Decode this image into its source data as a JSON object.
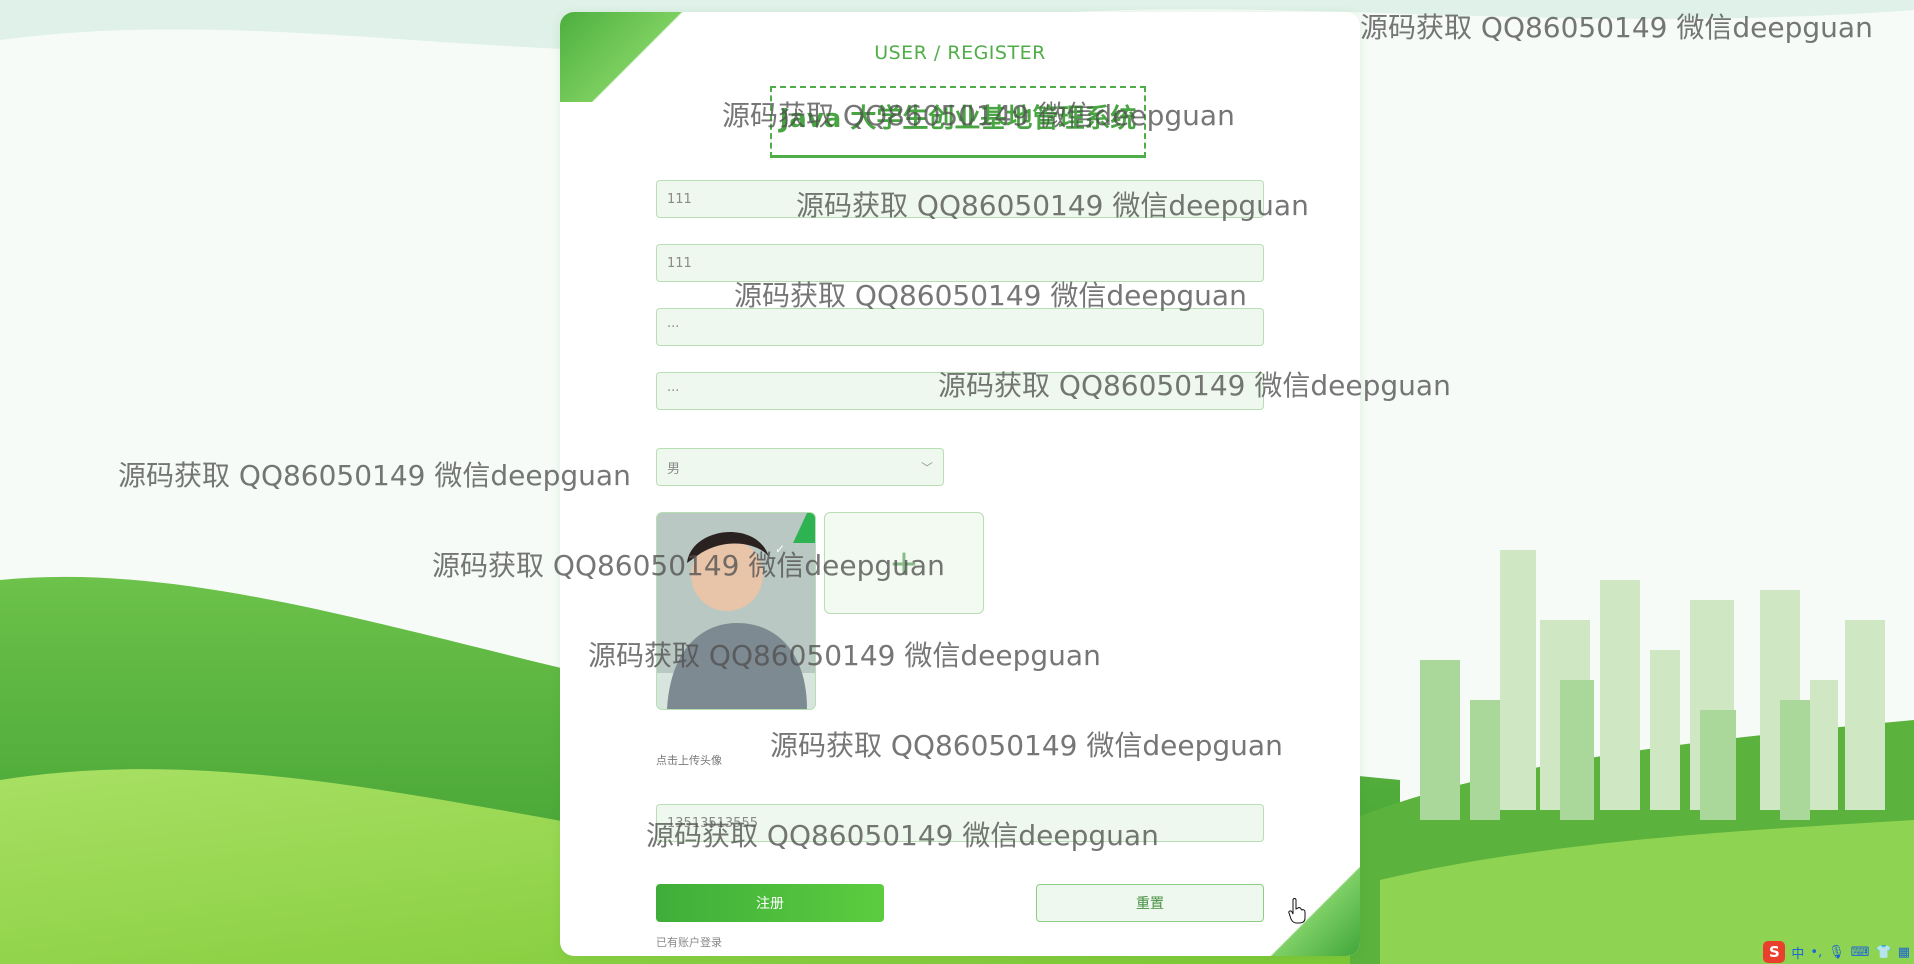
{
  "header": {
    "text": "USER / REGISTER"
  },
  "title_box": {
    "text": "Java 大学生创业基地管理系统"
  },
  "form": {
    "account_value": "111",
    "name_value": "111",
    "password_value": "···",
    "confirm_password_value": "···",
    "gender_value": "男",
    "upload_label": "点击上传头像",
    "phone_value": "13513513555"
  },
  "buttons": {
    "register": "注册",
    "reset": "重置"
  },
  "login_link": "已有账户登录",
  "watermark": "源码获取 QQ86050149 微信deepguan",
  "ime": {
    "logo": "S",
    "mode": "中"
  },
  "colors": {
    "accent": "#4fae47",
    "button": "#3eae3a"
  }
}
